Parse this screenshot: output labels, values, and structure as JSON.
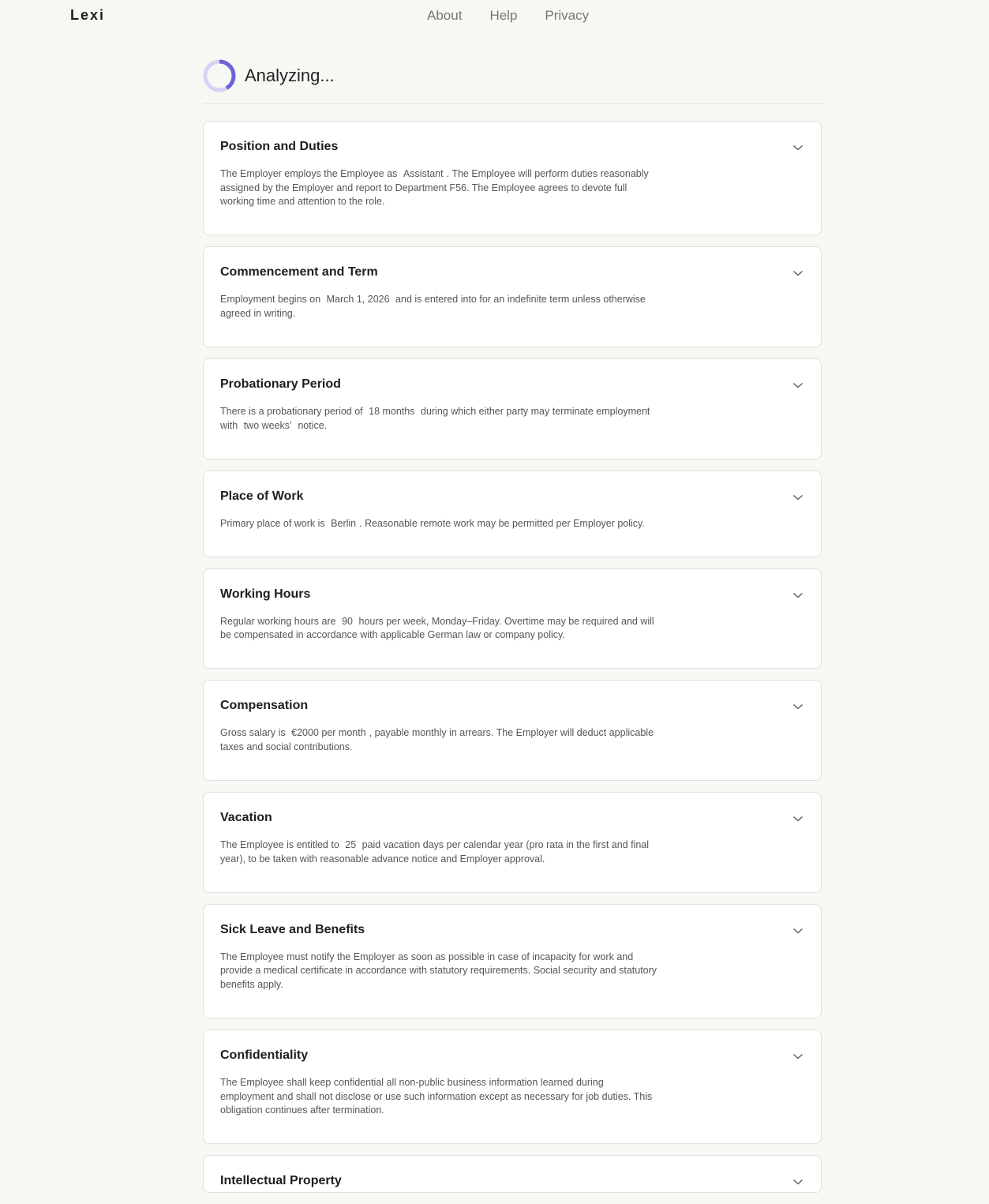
{
  "header": {
    "brand": "Lexi",
    "nav": [
      {
        "label": "About"
      },
      {
        "label": "Help"
      },
      {
        "label": "Privacy"
      }
    ]
  },
  "status": {
    "text": "Analyzing...",
    "spinner_color": "#6b63d9",
    "spinner_track_color": "#d5d2f4"
  },
  "sections": [
    {
      "title": "Position and Duties",
      "parts": [
        "The Employer employs the Employee as ",
        "Assistant",
        ". The Employee will perform duties reasonably assigned by the Employer and report to Department F56. The Employee agrees to devote full working time and attention to the role."
      ]
    },
    {
      "title": "Commencement and Term",
      "parts": [
        "Employment begins on ",
        "March 1, 2026",
        " and is entered into for an indefinite term unless otherwise agreed in writing."
      ]
    },
    {
      "title": "Probationary Period",
      "parts": [
        "There is a probationary period of ",
        "18 months",
        " during which either party may terminate employment with ",
        "two weeks’",
        " notice."
      ]
    },
    {
      "title": "Place of Work",
      "parts": [
        "Primary place of work is ",
        "Berlin",
        ". Reasonable remote work may be permitted per Employer policy."
      ]
    },
    {
      "title": "Working Hours",
      "parts": [
        "Regular working hours are ",
        "90",
        " hours per week, Monday–Friday. Overtime may be required and will be compensated in accordance with applicable German law or company policy."
      ]
    },
    {
      "title": "Compensation",
      "parts": [
        "Gross salary is ",
        "€2000 per month",
        ", payable monthly in arrears. The Employer will deduct applicable taxes and social contributions."
      ]
    },
    {
      "title": "Vacation",
      "parts": [
        "The Employee is entitled to ",
        "25",
        " paid vacation days per calendar year (pro rata in the first and final year), to be taken with reasonable advance notice and Employer approval."
      ]
    },
    {
      "title": "Sick Leave and Benefits",
      "parts": [
        "The Employee must notify the Employer as soon as possible in case of incapacity for work and provide a medical certificate in accordance with statutory requirements. Social security and statutory benefits apply."
      ]
    },
    {
      "title": "Confidentiality",
      "parts": [
        "The Employee shall keep confidential all non-public business information learned during employment and shall not disclose or use such information except as necessary for job duties. This obligation continues after termination."
      ]
    },
    {
      "title": "Intellectual Property",
      "parts": []
    }
  ]
}
